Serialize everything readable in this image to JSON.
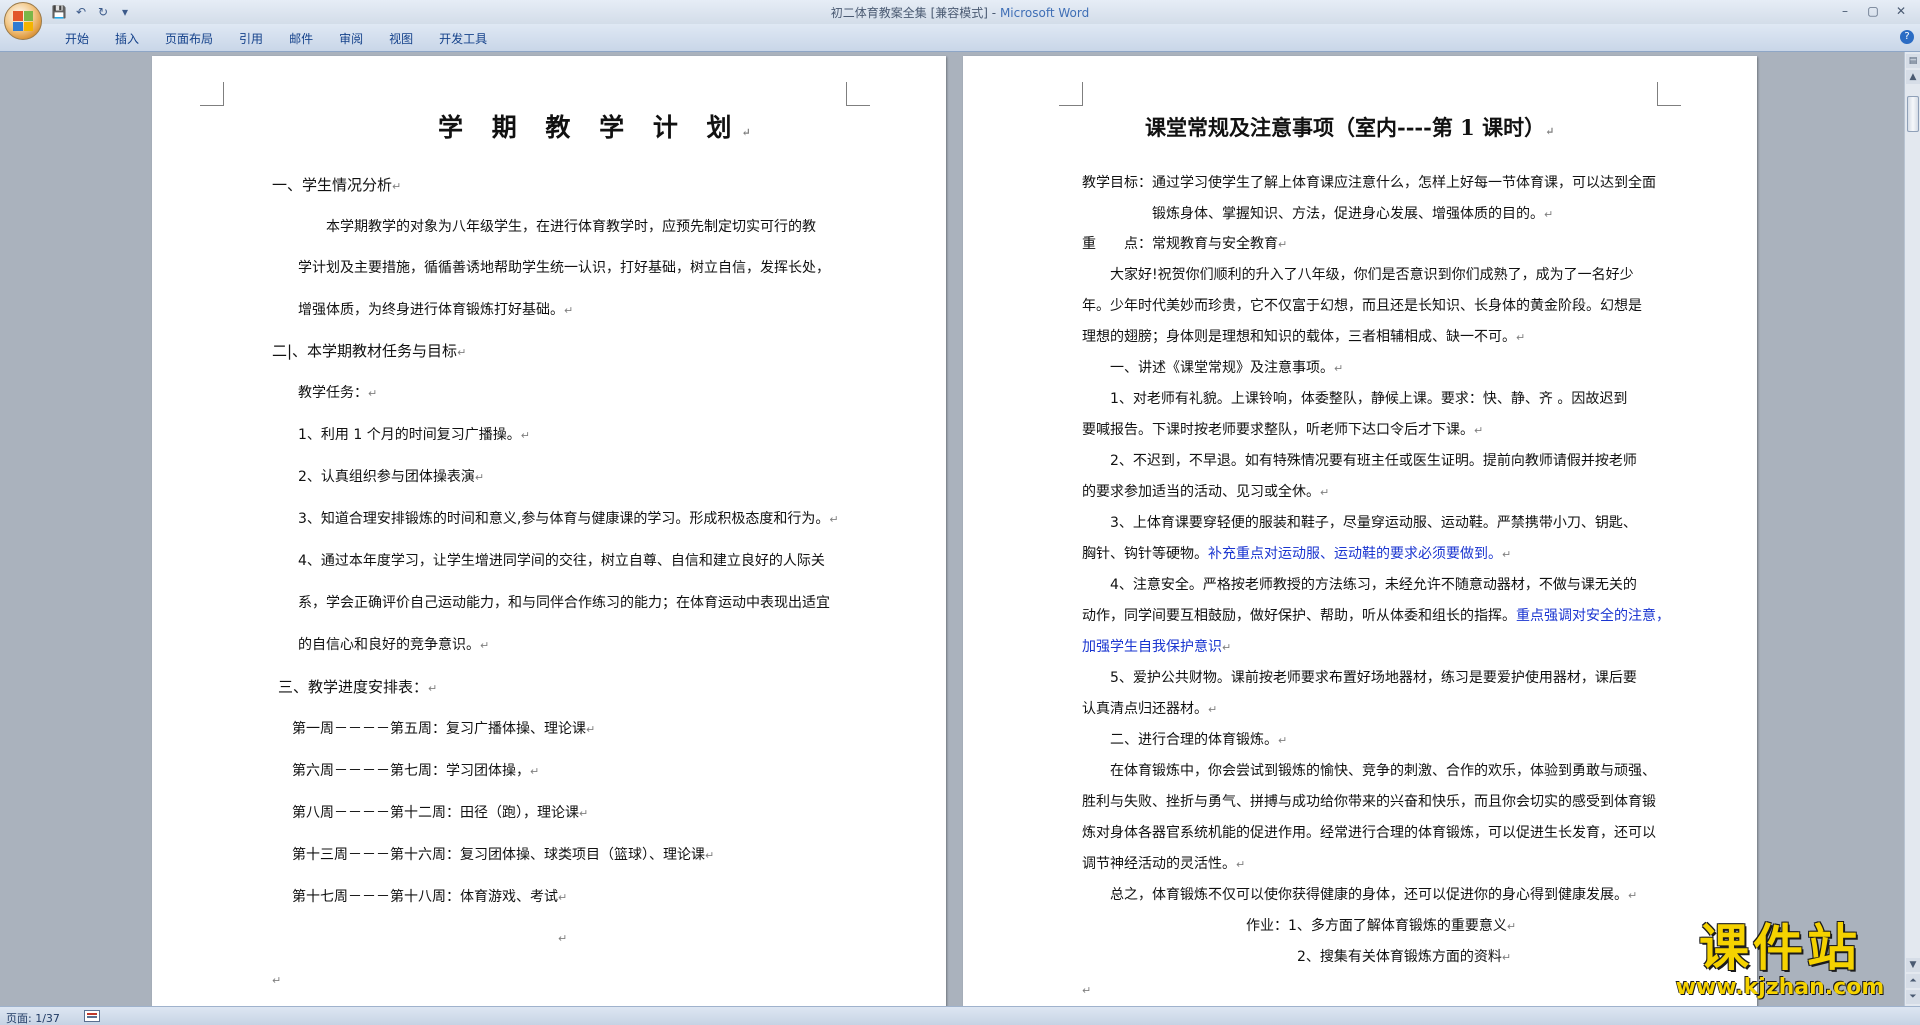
{
  "window": {
    "title": "初二体育教案全集 [兼容模式]",
    "title_separator": " - ",
    "app_name": "Microsoft Word"
  },
  "ribbon": {
    "tabs": [
      "开始",
      "插入",
      "页面布局",
      "引用",
      "邮件",
      "审阅",
      "视图",
      "开发工具"
    ]
  },
  "quick_access": [
    "save-icon",
    "undo-icon",
    "redo-icon",
    "customize-icon"
  ],
  "left_page": {
    "title": "学 期 教 学 计 划",
    "lines": [
      "一、学生情况分析",
      "本学期教学的对象为八年级学生，在进行体育教学时，应预先制定切实可行的教",
      "学计划及主要措施，循循善诱地帮助学生统一认识，打好基础，树立自信，发挥长处，",
      "增强体质，为终身进行体育锻炼打好基础。",
      "二|、本学期教材任务与目标",
      "教学任务：",
      "1、利用 1 个月的时间复习广播操。",
      "2、认真组织参与团体操表演",
      "3、知道合理安排锻炼的时间和意义,参与体育与健康课的学习。形成积极态度和行为。",
      "4、通过本年度学习，让学生增进同学间的交往，树立自尊、自信和建立良好的人际关",
      "系，学会正确评价自己运动能力，和与同伴合作练习的能力；在体育运动中表现出适宜",
      "的自信心和良好的竞争意识。",
      "三、教学进度安排表：",
      "第一周－－－－第五周：复习广播体操、理论课",
      "第六周－－－－第七周：学习团体操，",
      "第八周－－－－第十二周：田径（跑），理论课",
      "第十三周－－－第十六周：复习团体操、球类项目（篮球）、理论课",
      "第十七周－－－第十八周：体育游戏、考试"
    ]
  },
  "right_page": {
    "title": "课堂常规及注意事项（室内----第 1 课时）",
    "lines": [
      "教学目标：通过学习使学生了解上体育课应注意什么，怎样上好每一节体育课，可以达到全面",
      "锻炼身体、掌握知识、方法，促进身心发展、增强体质的目的。",
      "重　　点：常规教育与安全教育",
      "大家好!祝贺你们顺利的升入了八年级，你们是否意识到你们成熟了，成为了一名好少",
      "年。少年时代美妙而珍贵，它不仅富于幻想，而且还是长知识、长身体的黄金阶段。幻想是",
      "理想的翅膀；身体则是理想和知识的载体，三者相辅相成、缺一不可。",
      "一、讲述《课堂常规》及注意事项。",
      "1、对老师有礼貌。上课铃响，体委整队，静候上课。要求：快、静、齐 。因故迟到",
      "要喊报告。下课时按老师要求整队，听老师下达口令后才下课。",
      "2、不迟到，不早退。如有特殊情况要有班主任或医生证明。提前向教师请假并按老师",
      "的要求参加适当的活动、见习或全休。",
      "3、上体育课要穿轻便的服装和鞋子，尽量穿运动服、运动鞋。严禁携带小刀、钥匙、",
      "胸针、钩针等硬物。",
      "4、注意安全。严格按老师教授的方法练习，未经允许不随意动器材，不做与课无关的",
      "动作，同学间要互相鼓励，做好保护、帮助，听从体委和组长的指挥。",
      "5、爱护公共财物。课前按老师要求布置好场地器材，练习是要爱护使用器材，课后要",
      "认真清点归还器材。",
      "二、进行合理的体育锻炼。",
      "在体育锻炼中，你会尝试到锻炼的愉快、竞争的刺激、合作的欢乐，体验到勇敢与顽强、",
      "胜利与失败、挫折与勇气、拼搏与成功给你带来的兴奋和快乐，而且你会切实的感受到体育锻",
      "炼对身体各器官系统机能的促进作用。经常进行合理的体育锻炼，可以促进生长发育，还可以",
      "调节神经活动的灵活性。",
      "总之，体育锻炼不仅可以使你获得健康的身体，还可以促进你的身心得到健康发展。",
      "作业：1、多方面了解体育锻炼的重要意义",
      "2、搜集有关体育锻炼方面的资料"
    ],
    "highlights": [
      "补充重点对运动服、运动鞋的要求必须要做到。",
      "重点强调对安全的注意，",
      "加强学生自我保护意识"
    ]
  },
  "paragraph_mark": "↵",
  "status_bar": {
    "page": "页面: 1/37"
  },
  "watermark": {
    "main": "课件站",
    "url": "www.kjzhan.com"
  },
  "colors": {
    "highlight_text": "#1a35d0",
    "watermark": "#f5d200",
    "app_name": "#3f6fb6"
  }
}
